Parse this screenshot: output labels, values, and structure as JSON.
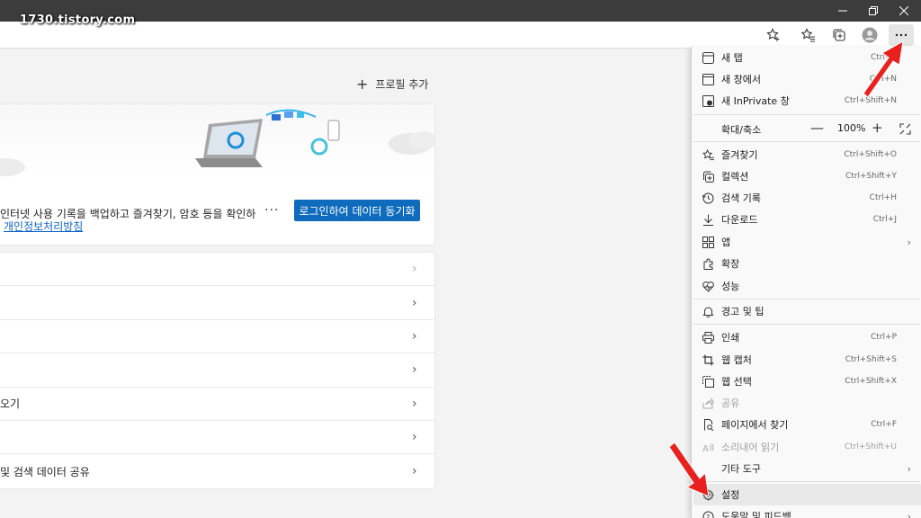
{
  "watermark": "1730.tistory.com",
  "page": {
    "add_profile": "프로필 추가",
    "sync_card": {
      "text": "인터넷 사용 기록을 백업하고 즐겨찾기, 암호 등을 확인하",
      "link": "개인정보처리방침",
      "more": "···",
      "button": "로그인하여 데이터 동기화"
    },
    "rows": [
      {
        "label": ""
      },
      {
        "label": ""
      },
      {
        "label": ""
      },
      {
        "label": ""
      },
      {
        "label": "오기"
      },
      {
        "label": ""
      },
      {
        "label": "및 검색 데이터 공유"
      }
    ]
  },
  "menu": {
    "items": [
      {
        "label": "새 탭",
        "shortcut": "Ctrl+T",
        "icon": "new-tab-icon"
      },
      {
        "label": "새 창에서",
        "shortcut": "Ctrl+N",
        "icon": "new-window-icon"
      },
      {
        "label": "새 InPrivate 창",
        "shortcut": "Ctrl+Shift+N",
        "icon": "inprivate-icon"
      },
      {
        "label": "즐겨찾기",
        "shortcut": "Ctrl+Shift+O",
        "icon": "favorites-icon"
      },
      {
        "label": "컬렉션",
        "shortcut": "Ctrl+Shift+Y",
        "icon": "collections-icon"
      },
      {
        "label": "검색 기록",
        "shortcut": "Ctrl+H",
        "icon": "history-icon"
      },
      {
        "label": "다운로드",
        "shortcut": "Ctrl+J",
        "icon": "download-icon"
      },
      {
        "label": "앱",
        "shortcut": "",
        "icon": "apps-icon"
      },
      {
        "label": "확장",
        "shortcut": "",
        "icon": "extensions-icon"
      },
      {
        "label": "성능",
        "shortcut": "",
        "icon": "performance-icon"
      },
      {
        "label": "경고 및 팁",
        "shortcut": "",
        "icon": "bell-icon"
      },
      {
        "label": "인쇄",
        "shortcut": "Ctrl+P",
        "icon": "print-icon"
      },
      {
        "label": "웹 캡처",
        "shortcut": "Ctrl+Shift+S",
        "icon": "web-capture-icon"
      },
      {
        "label": "웹 선택",
        "shortcut": "Ctrl+Shift+X",
        "icon": "web-select-icon"
      },
      {
        "label": "공유",
        "shortcut": "",
        "icon": "share-icon"
      },
      {
        "label": "페이지에서 찾기",
        "shortcut": "Ctrl+F",
        "icon": "find-icon"
      },
      {
        "label": "소리내어 읽기",
        "shortcut": "Ctrl+Shift+U",
        "icon": "read-aloud-icon"
      },
      {
        "label": "기타 도구",
        "shortcut": "",
        "icon": "more-tools-icon"
      },
      {
        "label": "설정",
        "shortcut": "",
        "icon": "gear-icon"
      },
      {
        "label": "도움말 및 피드백",
        "shortcut": "",
        "icon": "help-icon"
      }
    ],
    "zoom": {
      "label": "확대/축소",
      "minus": "—",
      "value": "100%",
      "plus": "+"
    }
  },
  "colors": {
    "accent": "#0f6cbd",
    "annotation_arrow": "#e8211f"
  }
}
